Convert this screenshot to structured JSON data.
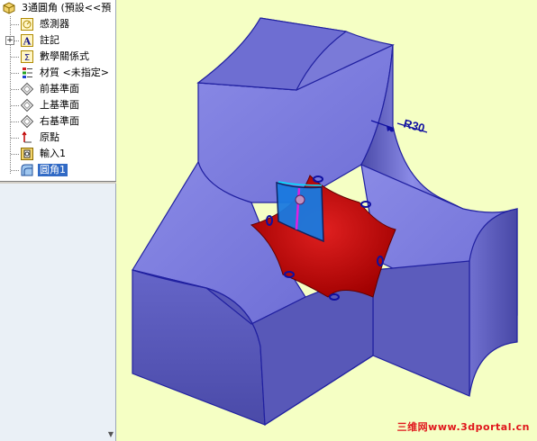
{
  "feature_tree": {
    "root_label": "3通圓角 (預設<<預",
    "items": [
      {
        "label": "感測器",
        "icon": "sensor-icon"
      },
      {
        "label": "註記",
        "icon": "annotation-icon",
        "expandable": true
      },
      {
        "label": "數學關係式",
        "icon": "equation-icon"
      },
      {
        "label": "材質 <未指定>",
        "icon": "material-icon"
      },
      {
        "label": "前基準面",
        "icon": "plane-icon"
      },
      {
        "label": "上基準面",
        "icon": "plane-icon"
      },
      {
        "label": "右基準面",
        "icon": "plane-icon"
      },
      {
        "label": "原點",
        "icon": "origin-icon"
      },
      {
        "label": "輸入1",
        "icon": "import-icon"
      },
      {
        "label": "圓角1",
        "icon": "fillet-icon",
        "selected": true
      }
    ]
  },
  "viewport": {
    "background": "#f5ffc4",
    "dimension_label": "R30",
    "watermark": "三维网www.3dportal.cn"
  },
  "colors": {
    "part_face": "#6c6cd8",
    "part_face_light": "#8a8ae6",
    "part_face_dark": "#4c4cb0",
    "fillet_face": "#c00000",
    "selection_blue": "#316ac5",
    "watermark": "#e0151b"
  }
}
